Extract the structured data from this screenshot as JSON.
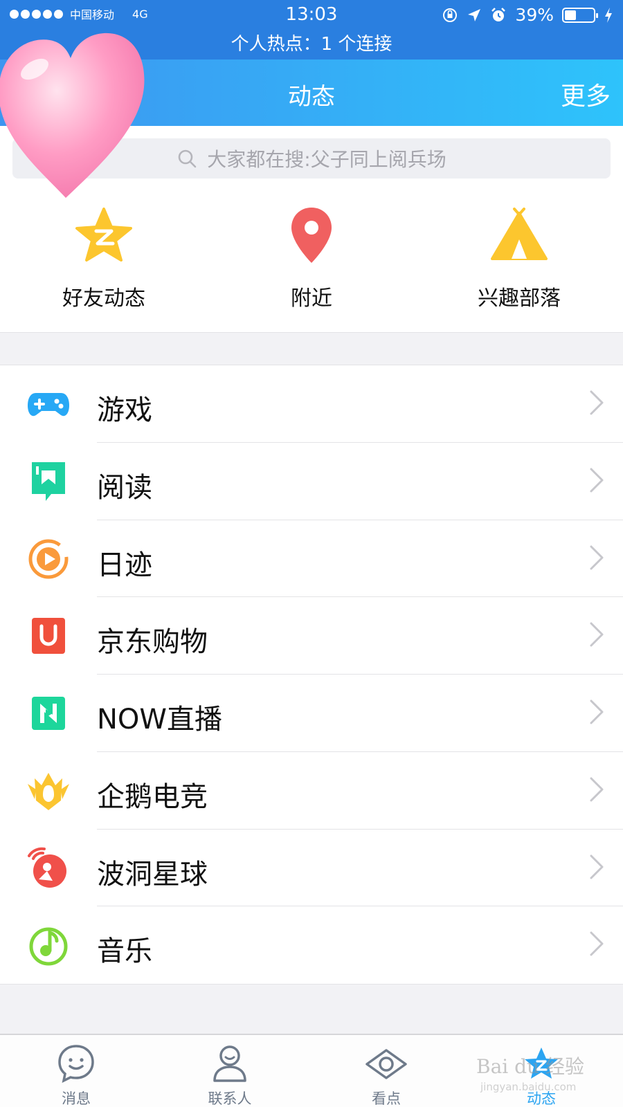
{
  "status_bar": {
    "carrier": "中国移动",
    "network": "4G",
    "time": "13:03",
    "battery": "39%",
    "battery_level": 0.39,
    "hotspot": "个人热点：1 个连接"
  },
  "header": {
    "title": "动态",
    "more": "更多"
  },
  "search": {
    "placeholder": "大家都在搜:父子同上阅兵场"
  },
  "quick_entries": [
    {
      "label": "好友动态",
      "icon": "qzone-star-icon",
      "color": "#fcc62e"
    },
    {
      "label": "附近",
      "icon": "location-pin-icon",
      "color": "#f06060"
    },
    {
      "label": "兴趣部落",
      "icon": "tent-icon",
      "color": "#fcc62e"
    }
  ],
  "list": [
    {
      "label": "游戏",
      "icon": "gamepad-icon",
      "color": "#27a8f5"
    },
    {
      "label": "阅读",
      "icon": "bookmark-icon",
      "color": "#1ed2a0"
    },
    {
      "label": "日迹",
      "icon": "play-circle-icon",
      "color": "#fa9a3b"
    },
    {
      "label": "京东购物",
      "icon": "jd-u-icon",
      "color": "#f0503c"
    },
    {
      "label": "NOW直播",
      "icon": "now-live-icon",
      "color": "#1dd69b"
    },
    {
      "label": "企鹅电竞",
      "icon": "esports-crown-icon",
      "color": "#fbc531"
    },
    {
      "label": "波洞星球",
      "icon": "bodong-planet-icon",
      "color": "#f0504a"
    },
    {
      "label": "音乐",
      "icon": "music-note-icon",
      "color": "#7fd73a"
    }
  ],
  "tabs": [
    {
      "label": "消息",
      "icon": "chat-smile-icon",
      "active": false
    },
    {
      "label": "联系人",
      "icon": "contact-person-icon",
      "active": false
    },
    {
      "label": "看点",
      "icon": "eye-icon",
      "active": false
    },
    {
      "label": "动态",
      "icon": "star-dynamic-icon",
      "active": true
    }
  ],
  "colors": {
    "status_bar": "#2a7fe0",
    "accent": "#2ba4f1",
    "header_gradient_start": "#3d95f0",
    "header_gradient_end": "#2ec3fb"
  },
  "watermark": {
    "brand": "Bai du 经验",
    "url": "jingyan.baidu.com"
  }
}
